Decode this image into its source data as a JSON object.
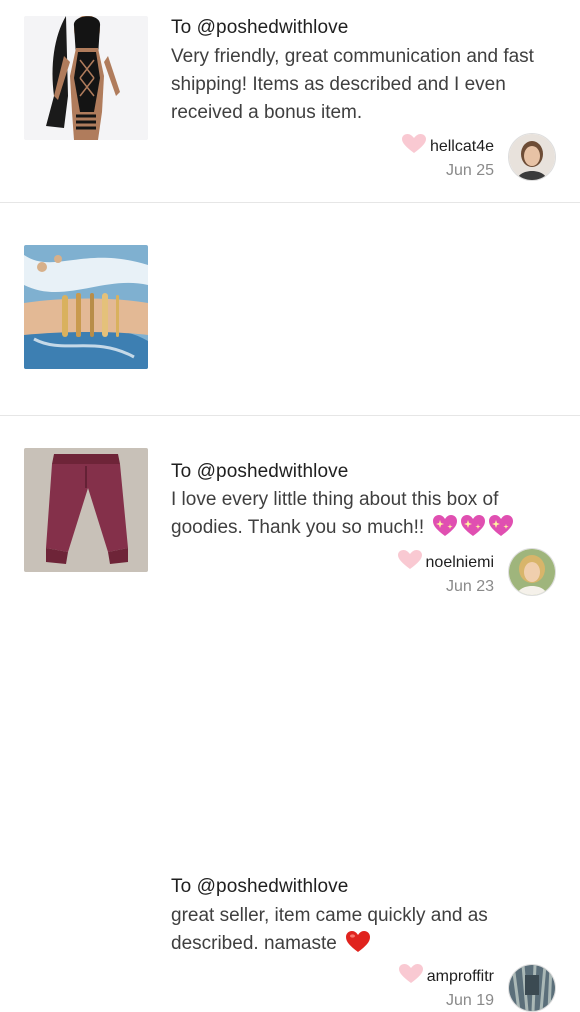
{
  "reviews": [
    {
      "to": "To @poshedwithlove",
      "body": "Very friendly, great communication and fast shipping! Items as described and I even received a bonus item.",
      "username": "hellcat4e",
      "date": "Jun 25",
      "thumb_icon": "swimsuit-photo",
      "avatar_icon": "user-avatar"
    },
    {
      "to": "To @poshedwithlove",
      "body": "I love every little thing about this box of goodies. Thank you so much!!",
      "body_emoji": "sparkling-heart-icon",
      "username": "noelniemi",
      "date": "Jun 23",
      "thumb_icon": "bracelets-photo",
      "avatar_icon": "user-avatar"
    },
    {
      "to": "To @poshedwithlove",
      "body": "great seller, item came quickly and as described. namaste",
      "body_emoji": "red-heart-icon",
      "username": "amproffitr",
      "date": "Jun 19",
      "thumb_icon": "pants-photo",
      "avatar_icon": "user-avatar"
    }
  ],
  "colors": {
    "heart": "#f9c9d2",
    "text": "#3f3f3f",
    "date": "#8a8a8a",
    "divider": "#e6e6e6"
  }
}
